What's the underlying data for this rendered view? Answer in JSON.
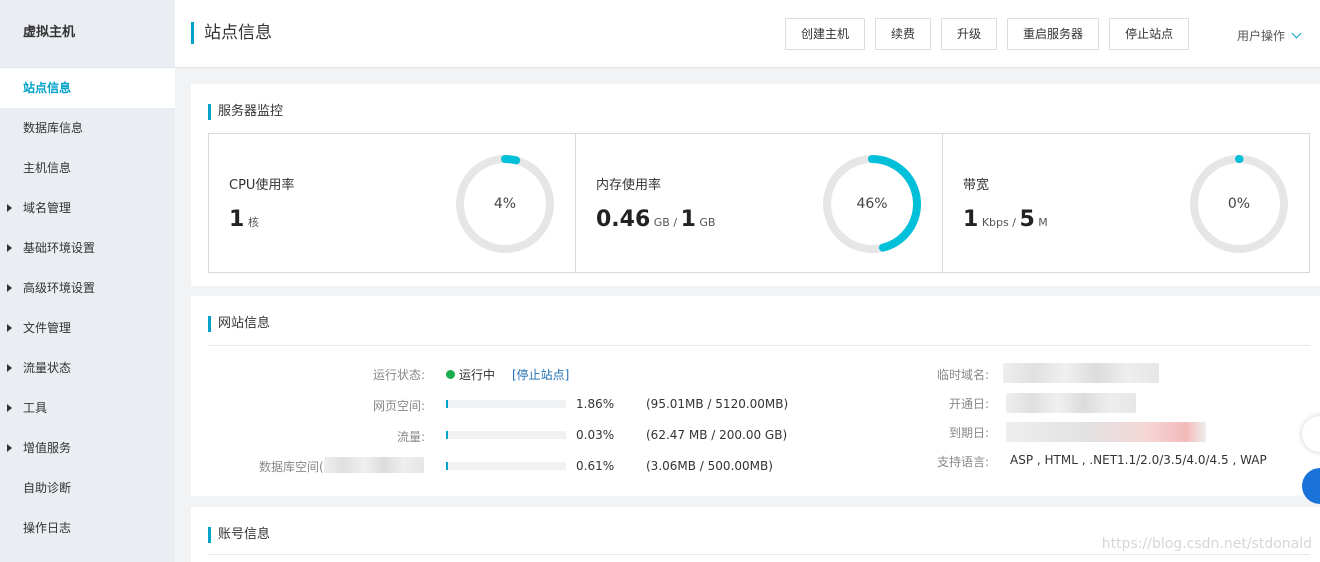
{
  "sidebar": {
    "title": "虚拟主机",
    "items": [
      {
        "label": "站点信息",
        "active": true,
        "expandable": false
      },
      {
        "label": "数据库信息",
        "active": false,
        "expandable": false
      },
      {
        "label": "主机信息",
        "active": false,
        "expandable": false
      },
      {
        "label": "域名管理",
        "active": false,
        "expandable": true
      },
      {
        "label": "基础环境设置",
        "active": false,
        "expandable": true
      },
      {
        "label": "高级环境设置",
        "active": false,
        "expandable": true
      },
      {
        "label": "文件管理",
        "active": false,
        "expandable": true
      },
      {
        "label": "流量状态",
        "active": false,
        "expandable": true
      },
      {
        "label": "工具",
        "active": false,
        "expandable": true
      },
      {
        "label": "增值服务",
        "active": false,
        "expandable": true
      },
      {
        "label": "自助诊断",
        "active": false,
        "expandable": false
      },
      {
        "label": "操作日志",
        "active": false,
        "expandable": false
      }
    ]
  },
  "header": {
    "title": "站点信息",
    "buttons": [
      "创建主机",
      "续费",
      "升级",
      "重启服务器",
      "停止站点"
    ],
    "user_ops": "用户操作"
  },
  "monitor": {
    "title": "服务器监控",
    "cpu": {
      "label": "CPU使用率",
      "value": "1",
      "unit": "核",
      "percent_text": "4%",
      "percent": 4
    },
    "memory": {
      "label": "内存使用率",
      "used": "0.46",
      "used_unit": "GB",
      "sep": "/",
      "total": "1",
      "total_unit": "GB",
      "percent_text": "46%",
      "percent": 46
    },
    "bandwidth": {
      "label": "带宽",
      "used": "1",
      "used_unit": "Kbps",
      "sep": "/",
      "total": "5",
      "total_unit": "M",
      "percent_text": "0%",
      "percent": 0
    }
  },
  "site": {
    "title": "网站信息",
    "run_status_label": "运行状态:",
    "run_status_value": "运行中",
    "stop_link": "[停止站点]",
    "web_space_label": "网页空间:",
    "web_space_percent_text": "1.86%",
    "web_space_percent": 1.86,
    "web_space_detail": "(95.01MB / 5120.00MB)",
    "traffic_label": "流量:",
    "traffic_percent_text": "0.03%",
    "traffic_percent": 0.03,
    "traffic_detail": "(62.47 MB / 200.00 GB)",
    "db_space_label": "数据库空间(",
    "db_space_percent_text": "0.61%",
    "db_space_percent": 0.61,
    "db_space_detail": "(3.06MB / 500.00MB)",
    "temp_domain_label": "临时域名:",
    "open_date_label": "开通日:",
    "expire_date_label": "到期日:",
    "languages_label": "支持语言:",
    "languages_value": "ASP , HTML , .NET1.1/2.0/3.5/4.0/4.5 , WAP"
  },
  "account": {
    "title": "账号信息"
  },
  "watermark": "https://blog.csdn.net/stdonald",
  "colors": {
    "accent": "#00a2ca",
    "status_green": "#1aad4b",
    "ring_track": "#e6e6e6"
  }
}
